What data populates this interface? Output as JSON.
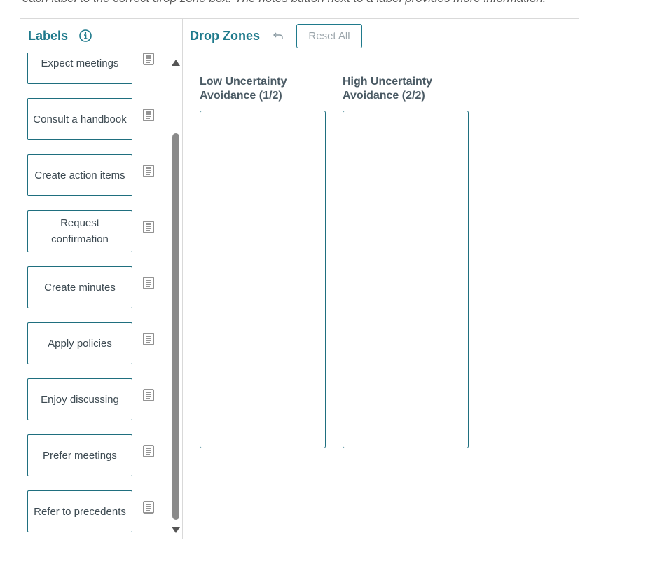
{
  "instruction": "each label to the correct drop zone box. The notes button next to a label provides more information.",
  "labels_panel": {
    "title": "Labels",
    "info_icon": "info-circle-icon"
  },
  "labels": [
    {
      "text": "Expect meetings"
    },
    {
      "text": "Consult a handbook"
    },
    {
      "text": "Create action items"
    },
    {
      "text": "Request confirmation"
    },
    {
      "text": "Create minutes"
    },
    {
      "text": "Apply policies"
    },
    {
      "text": "Enjoy discussing"
    },
    {
      "text": "Prefer meetings"
    },
    {
      "text": "Refer to precedents"
    }
  ],
  "zones_panel": {
    "title": "Drop Zones",
    "undo_icon": "undo-arrow-icon",
    "reset_label": "Reset All"
  },
  "zones": [
    {
      "title": "Low Uncertainty Avoidance (1/2)"
    },
    {
      "title": "High Uncertainty Avoidance (2/2)"
    }
  ],
  "colors": {
    "accent": "#1f7a8c",
    "border": "#1f6f7f",
    "divider": "#d9d9d9"
  }
}
